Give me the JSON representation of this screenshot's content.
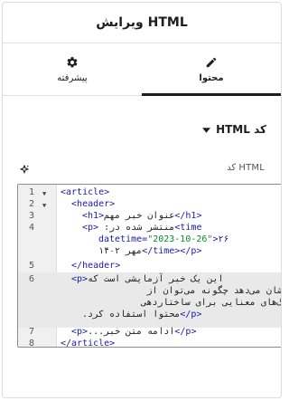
{
  "title": "ویرایش HTML",
  "tabs": [
    {
      "label": "محتوا",
      "icon": "pencil-icon",
      "active": true
    },
    {
      "label": "پیشرفته",
      "icon": "gear-icon",
      "active": false
    }
  ],
  "section": {
    "label": "کد HTML",
    "icon": "chevron-down-icon"
  },
  "field": {
    "label": "کد HTML",
    "action_icon": "sparkle-icon"
  },
  "editor": {
    "line_numbers": [
      "1",
      "2",
      "3",
      "4",
      "5",
      "6",
      "7",
      "8"
    ],
    "active_line": "6",
    "lines": {
      "l1": "<article>",
      "l2": "  <header>",
      "l3_tag_open": "<h1>",
      "l3_text": "عنوان خبر مهم",
      "l3_tag_close": "</h1>",
      "l4_a": "<p>",
      "l4_b": "منتشر شده در: ",
      "l4_c": "<time",
      "l4_d": "datetime=",
      "l4_e": "\"2023-10-26\"",
      "l4_f": ">۲۶",
      "l4_g": "مهر ۱۴۰۲",
      "l4_h": "</time></p>",
      "l5": "  </header>",
      "l6_a": "<p>",
      "l6_b": "این یک خبر آزمایشی است که",
      "l6_c": "نشان می‌دهد چگونه می‌توان از",
      "l6_d": "تگ‌های معنایی برای ساختاردهی",
      "l6_e": "محتوا استفاده کرد.",
      "l6_f": "</p>",
      "l7_a": "<p>",
      "l7_b": "ادامه متن خبر...",
      "l7_c": "</p>",
      "l8": "</article>"
    }
  },
  "colors": {
    "text": "#1e1e1e",
    "tag": "#1a1aa6",
    "string": "#0b8a2e",
    "border": "#dcdcdc"
  }
}
